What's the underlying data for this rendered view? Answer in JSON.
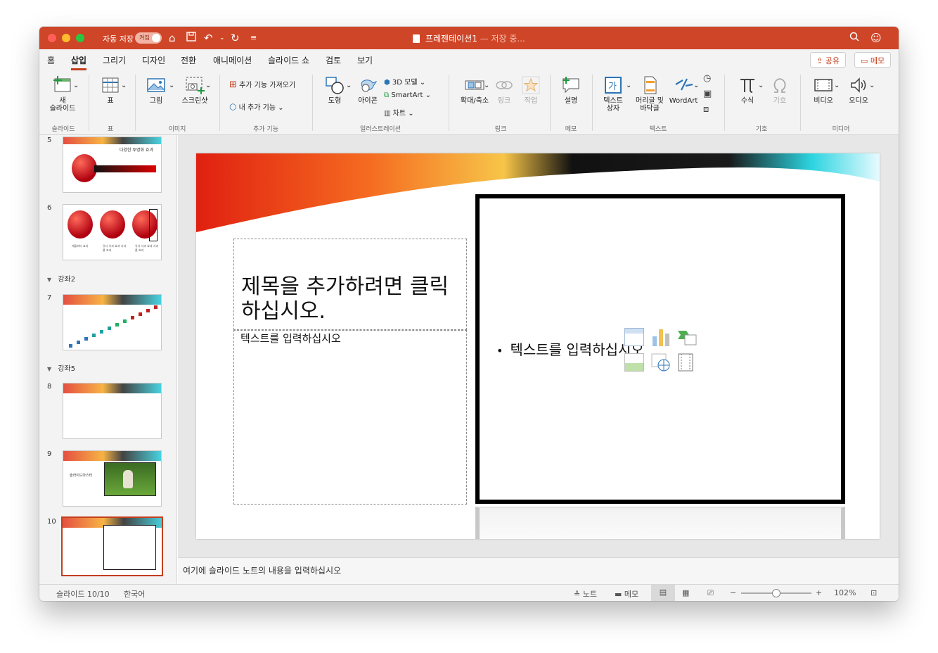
{
  "titlebar": {
    "autosave_label": "자동 저장",
    "autosave_state": "켜짐",
    "doc_name": "프레젠테이션1",
    "doc_status": "— 저장 중..."
  },
  "tabs": [
    {
      "label": "홈"
    },
    {
      "label": "삽입",
      "active": true
    },
    {
      "label": "그리기"
    },
    {
      "label": "디자인"
    },
    {
      "label": "전환"
    },
    {
      "label": "애니메이션"
    },
    {
      "label": "슬라이드 쇼"
    },
    {
      "label": "검토"
    },
    {
      "label": "보기"
    }
  ],
  "share_label": "공유",
  "comments_label": "메모",
  "ribbon": {
    "new_slide_1": "새",
    "new_slide_2": "슬라이드",
    "group_slides": "슬라이드",
    "table": "표",
    "group_table": "표",
    "picture": "그림",
    "screenshot": "스크린샷",
    "group_images": "이미지",
    "get_addins": "추가 기능 가져오기",
    "my_addins": "내 추가 기능",
    "group_addins": "추가 기능",
    "shapes": "도형",
    "icons": "아이콘",
    "models_3d": "3D 모델",
    "smartart": "SmartArt",
    "chart": "차트",
    "group_illustrations": "일러스트레이션",
    "zoom": "확대/축소",
    "link": "링크",
    "action": "작업",
    "group_links": "링크",
    "comment": "설명",
    "group_comments": "메모",
    "textbox_1": "텍스트",
    "textbox_2": "상자",
    "header_footer_1": "머리글 및",
    "header_footer_2": "바닥글",
    "wordart": "WordArt",
    "group_text": "텍스트",
    "equation": "수식",
    "symbol": "기호",
    "group_symbols": "기호",
    "video": "비디오",
    "audio": "오디오",
    "group_media": "미디어"
  },
  "thumbnails": {
    "n5": "5",
    "n6": "6",
    "n7": "7",
    "n8": "8",
    "n9": "9",
    "n10": "10",
    "section_2": "강좌2",
    "section_5": "강좌5",
    "slide5_title": "다양한 투명화 효과",
    "slide6_cap1": "애플파티 효과",
    "slide6_cap2": "유사 사과 효과 사과를 효과",
    "slide6_cap3": "유사 사과 효과 사과를 효과",
    "slide9_title": "슬라이드마스터"
  },
  "slide": {
    "title_placeholder": "제목을 추가하려면 클릭하십시오.",
    "text_placeholder": "텍스트를 입력하십시오",
    "content_placeholder": "텍스트를 입력하십시오"
  },
  "notes_placeholder": "여기에 슬라이드 노트의 내용을 입력하십시오",
  "status": {
    "slide_counter": "슬라이드 10/10",
    "language": "한국어",
    "notes": "노트",
    "comments": "메모",
    "zoom": "102%",
    "zoom_fraction": 0.5
  },
  "colors": {
    "accent": "#c43e1c",
    "titlebar": "#cf4528"
  }
}
